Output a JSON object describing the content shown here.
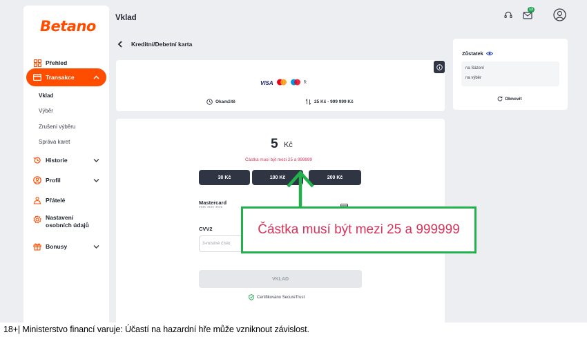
{
  "brand": {
    "logo": "Betano",
    "accent": "#ff4d00"
  },
  "sidebar": {
    "items": [
      {
        "label": "Přehled",
        "icon": "grid-icon"
      },
      {
        "label": "Transakce",
        "icon": "card-icon",
        "active": true
      },
      {
        "label": "Historie",
        "icon": "history-icon"
      },
      {
        "label": "Profil",
        "icon": "user-icon"
      },
      {
        "label": "Přátelé",
        "icon": "friends-icon"
      },
      {
        "label": "Nastavení osobních údajů",
        "icon": "settings-icon"
      },
      {
        "label": "Bonusy",
        "icon": "gift-icon"
      }
    ],
    "sub_items": [
      "Vklad",
      "Výběr",
      "Zrušení výběru",
      "Správa karet"
    ]
  },
  "header": {
    "title": "Vklad",
    "mail_badge": "12"
  },
  "method": {
    "back_label": "Kreditní/Debetní karta",
    "logo_suffix": "R",
    "processing": "Okamžitě",
    "limits": "25 Kč - 999 999 Kč"
  },
  "deposit": {
    "amount": "5",
    "currency": "Kč",
    "error": "Částka musí být mezi 25 a 999999",
    "quick_amounts": [
      "30 Kč",
      "100 Kč",
      "200 Kč"
    ],
    "card_label": "Mastercard",
    "card_number": "**** **** ****",
    "cvv_label": "CVV2",
    "cvv_placeholder": "3-místné číslo",
    "submit": "VKLAD",
    "secure": "Certifikováno SecureTrust"
  },
  "balance": {
    "title": "Zůstatek",
    "line1": "na Sázení",
    "line2": "na výběr",
    "refresh": "Obnovit"
  },
  "annotation": {
    "text": "Částka musí být mezi 25 a 999999",
    "color": "#22b14c"
  },
  "footer": {
    "disclaimer": "18+| Ministerstvo financí varuje: Účastí na hazardní hře může vzniknout závislost."
  }
}
